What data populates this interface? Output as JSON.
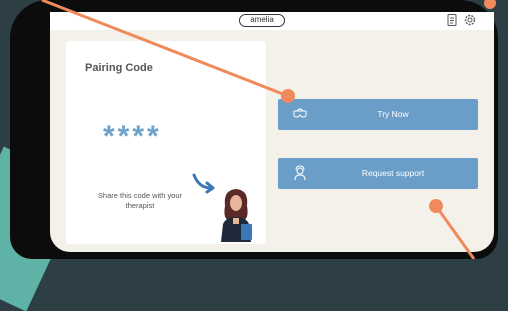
{
  "header": {
    "logo_text": "amelia",
    "icons": [
      "document-icon",
      "gear-icon"
    ]
  },
  "pairing": {
    "title": "Pairing Code",
    "code": "****",
    "share_text": "Share this code with your therapist"
  },
  "actions": {
    "try_now": {
      "label": "Try Now",
      "icon": "vr-headset-icon"
    },
    "request_support": {
      "label": "Request support",
      "icon": "support-agent-icon"
    }
  },
  "colors": {
    "primary": "#6a9ec8",
    "background": "#f4f1ea",
    "annotation": "#f08a5d",
    "teal": "#5fb3a6"
  }
}
